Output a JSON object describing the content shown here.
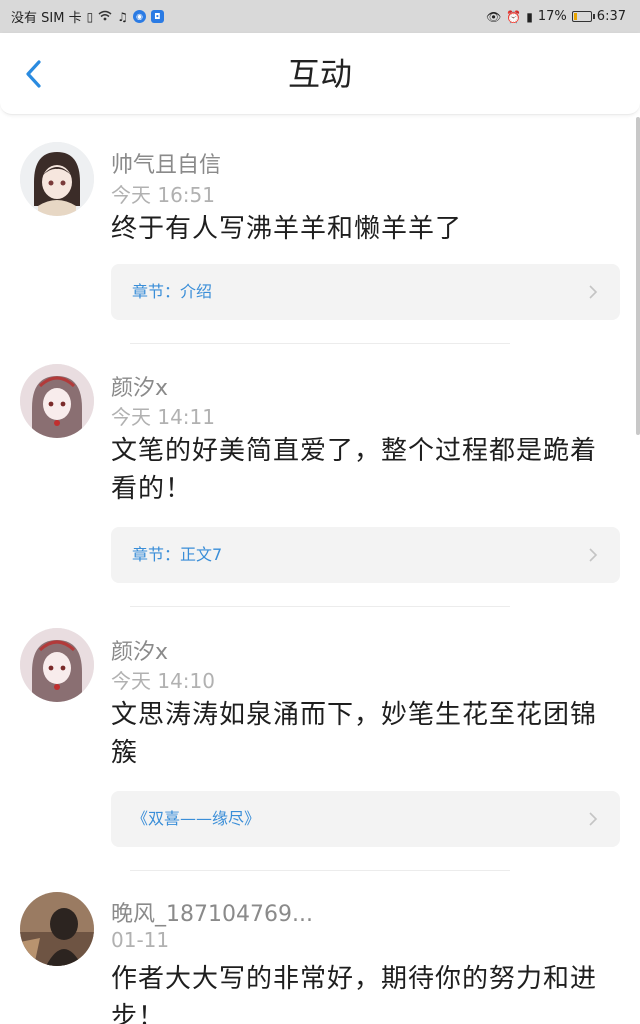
{
  "status_bar": {
    "carrier": "没有 SIM 卡",
    "battery": "17%",
    "time": "6:37"
  },
  "header": {
    "title": "互动",
    "back_icon": "chevron-left-icon"
  },
  "colors": {
    "accent": "#3a8ed8",
    "name_text": "#8a8a8a",
    "time_text": "#b1b1b1",
    "chapter_bg": "#f3f3f3"
  },
  "comments": [
    {
      "user": "帅气且自信",
      "time": "今天 16:51",
      "text": "终于有人写沸羊羊和懒羊羊了",
      "chapter": "章节：介绍"
    },
    {
      "user": "颜汐x",
      "time": "今天 14:11",
      "text": "文笔的好美简直爱了，整个过程都是跪着看的！",
      "chapter": "章节：正文7"
    },
    {
      "user": "颜汐x",
      "time": "今天 14:10",
      "text": "文思涛涛如泉涌而下，妙笔生花至花团锦簇",
      "chapter": "《双喜——缘尽》"
    },
    {
      "user": "晚风_187104769...",
      "time": "01-11",
      "text": "作者大大写的非常好，期待你的努力和进步！",
      "chapter": ""
    }
  ]
}
